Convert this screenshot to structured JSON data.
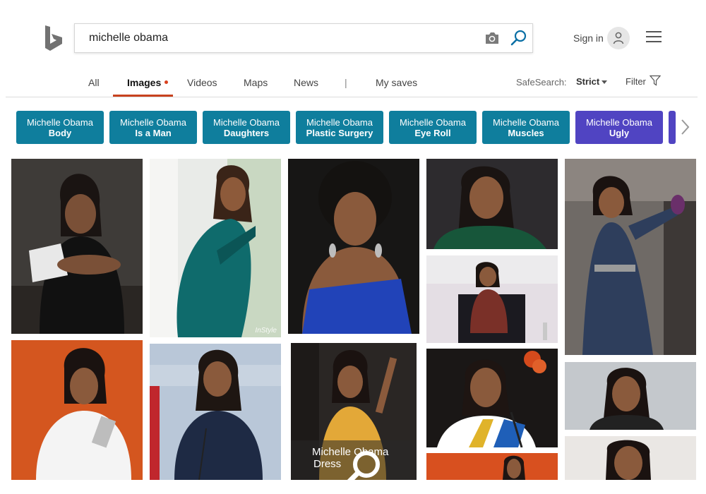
{
  "search": {
    "query": "michelle obama"
  },
  "header": {
    "sign_in": "Sign in"
  },
  "tabs": [
    {
      "label": "All"
    },
    {
      "label": "Images"
    },
    {
      "label": "Videos"
    },
    {
      "label": "Maps"
    },
    {
      "label": "News"
    },
    {
      "label": "|"
    },
    {
      "label": "My saves"
    }
  ],
  "safesearch": {
    "label": "SafeSearch:",
    "value": "Strict"
  },
  "filter": {
    "label": "Filter"
  },
  "related": [
    {
      "line1": "Michelle Obama",
      "line2": "Body"
    },
    {
      "line1": "Michelle Obama",
      "line2": "Is a Man"
    },
    {
      "line1": "Michelle Obama",
      "line2": "Daughters"
    },
    {
      "line1": "Michelle Obama",
      "line2": "Plastic Surgery"
    },
    {
      "line1": "Michelle Obama",
      "line2": "Eye Roll"
    },
    {
      "line1": "Michelle Obama",
      "line2": "Muscles"
    },
    {
      "line1": "Michelle Obama",
      "line2": "Ugly"
    }
  ],
  "images": {
    "watermark": "InStyle",
    "hover_line1": "Michelle Obama",
    "hover_line2": "Dress"
  },
  "colors": {
    "accent": "#c8421e",
    "chip": "#0f7e9d",
    "chip_alt": "#5044c2",
    "link": "#0a6fa5"
  }
}
